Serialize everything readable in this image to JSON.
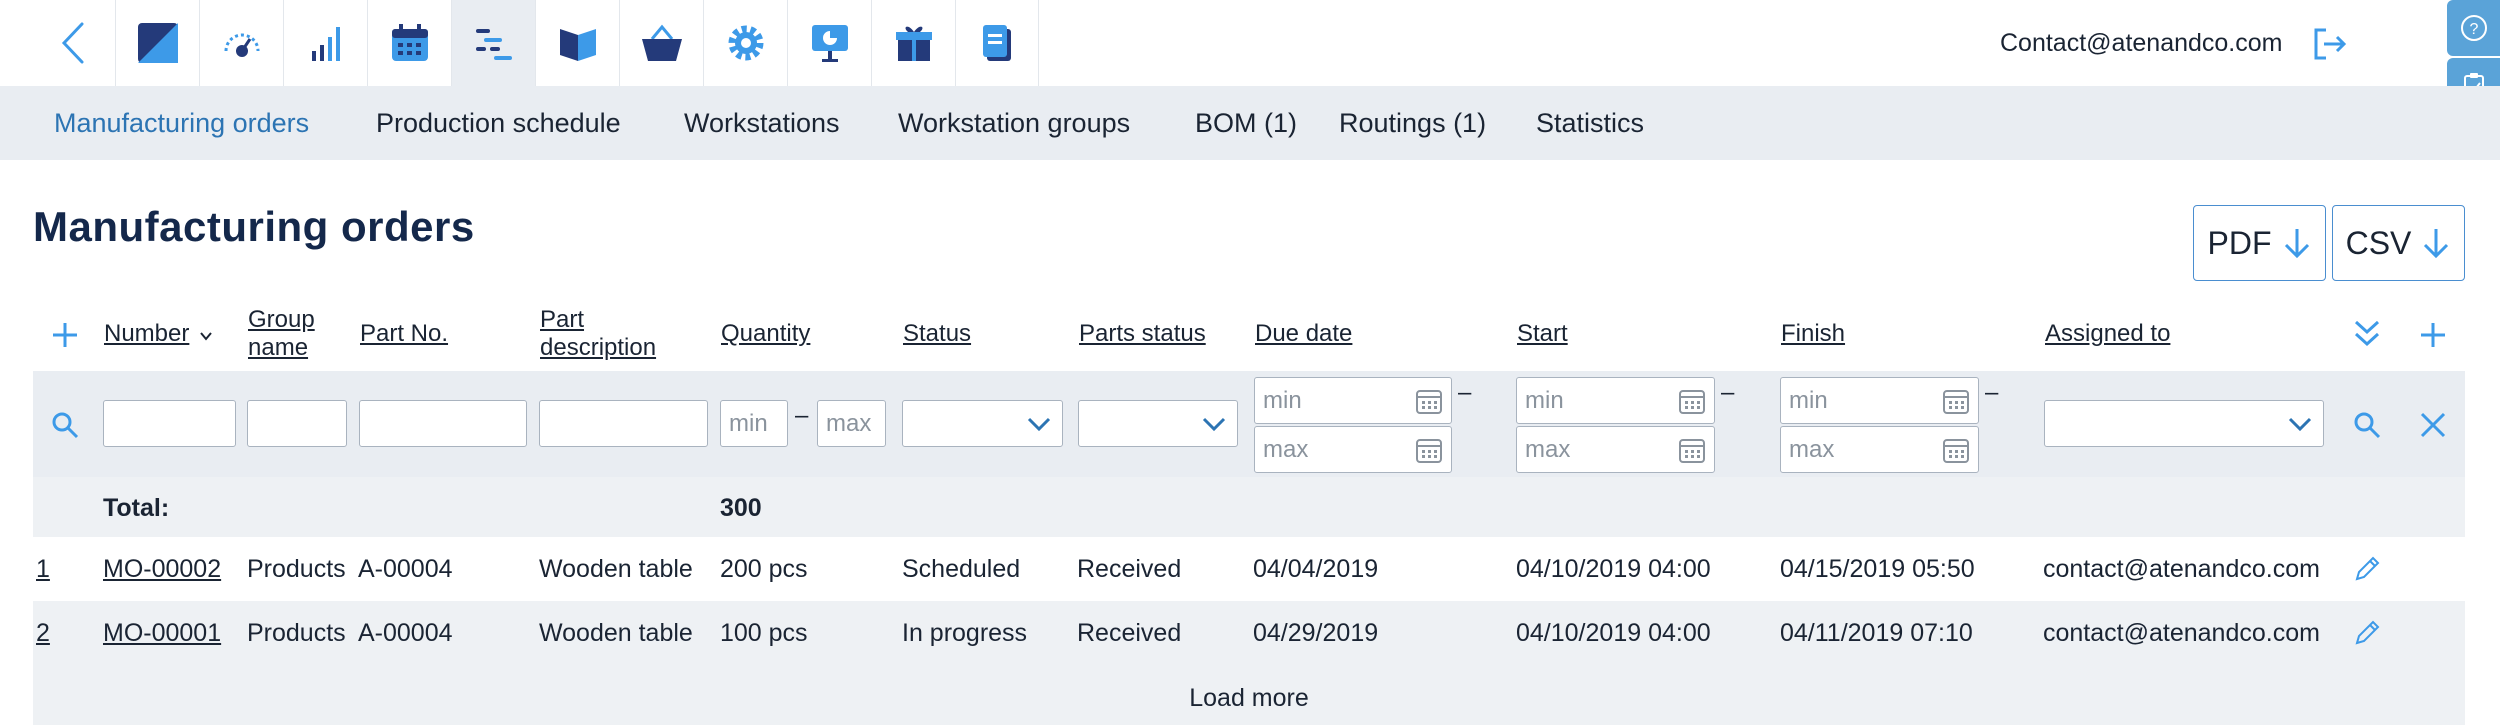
{
  "topbar": {
    "icons": [
      "app-logo-icon",
      "dashboard-gauge-icon",
      "reports-bars-icon",
      "calendar-icon",
      "production-gantt-icon",
      "book-icon",
      "basket-icon",
      "settings-gear-icon",
      "presentation-icon",
      "gift-icon",
      "documents-icon"
    ],
    "active_icon": "production-gantt-icon",
    "user_email": "Contact@atenandco.com"
  },
  "subnav": {
    "tabs": [
      {
        "label": "Manufacturing orders",
        "active": true
      },
      {
        "label": "Production schedule",
        "active": false
      },
      {
        "label": "Workstations",
        "active": false
      },
      {
        "label": "Workstation groups",
        "active": false
      },
      {
        "label": "BOM (1)",
        "active": false
      },
      {
        "label": "Routings (1)",
        "active": false
      },
      {
        "label": "Statistics",
        "active": false
      }
    ]
  },
  "page": {
    "title": "Manufacturing orders",
    "pdf_label": "PDF",
    "csv_label": "CSV"
  },
  "table": {
    "headers": {
      "number": "Number",
      "group_line1": "Group",
      "group_line2": "name",
      "part_no": "Part No.",
      "desc_line1": "Part",
      "desc_line2": "description",
      "quantity": "Quantity",
      "status": "Status",
      "parts_status": "Parts status",
      "due_date": "Due date",
      "start": "Start",
      "finish": "Finish",
      "assigned_to": "Assigned to"
    },
    "filters": {
      "min": "min",
      "max": "max",
      "dash": "–"
    },
    "total": {
      "label": "Total:",
      "quantity": "300"
    },
    "rows": [
      {
        "index": "1",
        "number": "MO-00002",
        "group": "Products",
        "part_no": "A-00004",
        "description": "Wooden table",
        "quantity": "200 pcs",
        "status": "Scheduled",
        "parts_status": "Received",
        "due_date": "04/04/2019",
        "start": "04/10/2019 04:00",
        "finish": "04/15/2019 05:50",
        "assigned_to": "contact@atenandco.com"
      },
      {
        "index": "2",
        "number": "MO-00001",
        "group": "Products",
        "part_no": "A-00004",
        "description": "Wooden table",
        "quantity": "100 pcs",
        "status": "In progress",
        "parts_status": "Received",
        "due_date": "04/29/2019",
        "start": "04/10/2019 04:00",
        "finish": "04/11/2019 07:10",
        "assigned_to": "contact@atenandco.com"
      }
    ],
    "load_more": "Load more"
  },
  "colors": {
    "accent": "#2c74b3",
    "icon_blue": "#3d9ae8",
    "icon_navy": "#243a7a",
    "nav_bg": "#e9edf2",
    "title": "#14284b"
  }
}
